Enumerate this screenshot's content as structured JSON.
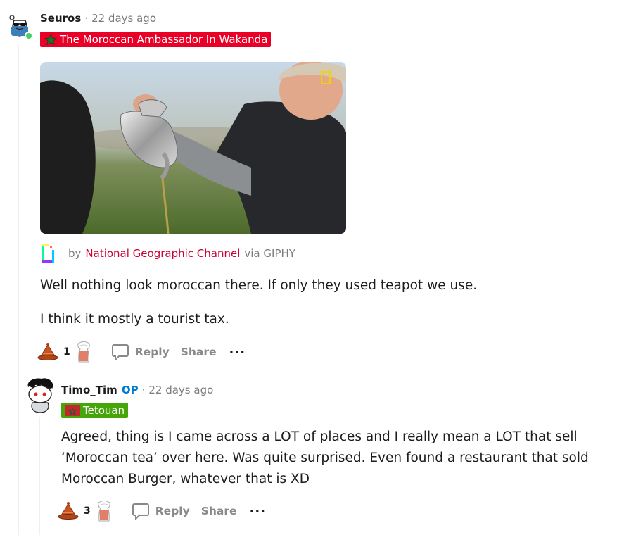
{
  "comment1": {
    "username": "Seuros",
    "separator": "·",
    "time": "22 days ago",
    "flair": {
      "text": "The Moroccan Ambassador In Wakanda",
      "bg": "#ea0027"
    },
    "gif_attribution": {
      "by": "by",
      "channel": "National Geographic Channel",
      "via": "via GIPHY"
    },
    "paragraphs": [
      "Well nothing look moroccan there. If only they used teapot we use.",
      "I think it mostly a tourist tax."
    ],
    "vote_count": "1",
    "reply_label": "Reply",
    "share_label": "Share",
    "more_label": "···"
  },
  "comment2": {
    "username": "Timo_Tim",
    "op_label": "OP",
    "separator": "·",
    "time": "22 days ago",
    "flair": {
      "text": "Tetouan",
      "bg": "#46a508"
    },
    "paragraph": "Agreed, thing is I came across a LOT of places and I really mean a LOT that sell ‘Moroccan tea’ over here. Was quite surprised. Even found a restaurant that sold Moroccan Burger, whatever that is XD",
    "vote_count": "3",
    "reply_label": "Reply",
    "share_label": "Share",
    "more_label": "···"
  },
  "colors": {
    "link_red": "#cc0033",
    "op_blue": "#0079d3",
    "meta_gray": "#7c7c7c",
    "online_green": "#46d160"
  }
}
